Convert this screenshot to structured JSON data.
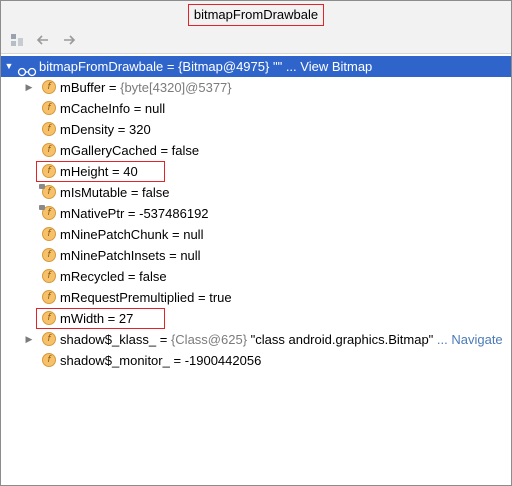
{
  "window": {
    "title": "bitmapFromDrawbale"
  },
  "toolbar": [
    {
      "name": "layout-icon"
    },
    {
      "name": "back-arrow-icon"
    },
    {
      "name": "forward-arrow-icon"
    }
  ],
  "root": {
    "name": "bitmapFromDrawbale",
    "value": " = {Bitmap@4975} \"\"",
    "link": "... View Bitmap"
  },
  "fields": [
    {
      "name": "mBuffer",
      "eq": " = ",
      "type": "{byte[4320]@5377}",
      "value": "",
      "expandable": true,
      "locked": false
    },
    {
      "name": "mCacheInfo",
      "eq": " = ",
      "type": "",
      "value": "null",
      "expandable": false,
      "locked": false
    },
    {
      "name": "mDensity",
      "eq": " = ",
      "type": "",
      "value": "320",
      "expandable": false,
      "locked": false
    },
    {
      "name": "mGalleryCached",
      "eq": " = ",
      "type": "",
      "value": "false",
      "expandable": false,
      "locked": false
    },
    {
      "name": "mHeight",
      "eq": " = ",
      "type": "",
      "value": "40",
      "expandable": false,
      "locked": false,
      "highlight": true
    },
    {
      "name": "mIsMutable",
      "eq": " = ",
      "type": "",
      "value": "false",
      "expandable": false,
      "locked": true
    },
    {
      "name": "mNativePtr",
      "eq": " = ",
      "type": "",
      "value": "-537486192",
      "expandable": false,
      "locked": true
    },
    {
      "name": "mNinePatchChunk",
      "eq": " = ",
      "type": "",
      "value": "null",
      "expandable": false,
      "locked": false
    },
    {
      "name": "mNinePatchInsets",
      "eq": " = ",
      "type": "",
      "value": "null",
      "expandable": false,
      "locked": false
    },
    {
      "name": "mRecycled",
      "eq": " = ",
      "type": "",
      "value": "false",
      "expandable": false,
      "locked": false
    },
    {
      "name": "mRequestPremultiplied",
      "eq": " = ",
      "type": "",
      "value": "true",
      "expandable": false,
      "locked": false
    },
    {
      "name": "mWidth",
      "eq": " = ",
      "type": "",
      "value": "27",
      "expandable": false,
      "locked": false,
      "highlight": true
    },
    {
      "name": "shadow$_klass_",
      "eq": " = ",
      "type": "{Class@625}",
      "value": " \"class android.graphics.Bitmap\"",
      "link": " ... Navigate",
      "expandable": true,
      "locked": false
    },
    {
      "name": "shadow$_monitor_",
      "eq": " = ",
      "type": "",
      "value": "-1900442056",
      "expandable": false,
      "locked": false
    }
  ],
  "colors": {
    "selection": "#2f65ca",
    "highlight_border": "#e0242a",
    "field_icon": "#f6c16a",
    "link": "#4b7bb7"
  }
}
